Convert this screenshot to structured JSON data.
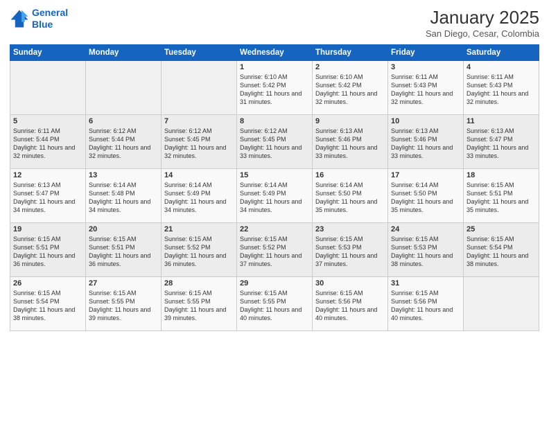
{
  "logo": {
    "line1": "General",
    "line2": "Blue"
  },
  "title": "January 2025",
  "location": "San Diego, Cesar, Colombia",
  "days_header": [
    "Sunday",
    "Monday",
    "Tuesday",
    "Wednesday",
    "Thursday",
    "Friday",
    "Saturday"
  ],
  "weeks": [
    [
      {
        "day": "",
        "info": ""
      },
      {
        "day": "",
        "info": ""
      },
      {
        "day": "",
        "info": ""
      },
      {
        "day": "1",
        "info": "Sunrise: 6:10 AM\nSunset: 5:42 PM\nDaylight: 11 hours\nand 31 minutes."
      },
      {
        "day": "2",
        "info": "Sunrise: 6:10 AM\nSunset: 5:42 PM\nDaylight: 11 hours\nand 32 minutes."
      },
      {
        "day": "3",
        "info": "Sunrise: 6:11 AM\nSunset: 5:43 PM\nDaylight: 11 hours\nand 32 minutes."
      },
      {
        "day": "4",
        "info": "Sunrise: 6:11 AM\nSunset: 5:43 PM\nDaylight: 11 hours\nand 32 minutes."
      }
    ],
    [
      {
        "day": "5",
        "info": "Sunrise: 6:11 AM\nSunset: 5:44 PM\nDaylight: 11 hours\nand 32 minutes."
      },
      {
        "day": "6",
        "info": "Sunrise: 6:12 AM\nSunset: 5:44 PM\nDaylight: 11 hours\nand 32 minutes."
      },
      {
        "day": "7",
        "info": "Sunrise: 6:12 AM\nSunset: 5:45 PM\nDaylight: 11 hours\nand 32 minutes."
      },
      {
        "day": "8",
        "info": "Sunrise: 6:12 AM\nSunset: 5:45 PM\nDaylight: 11 hours\nand 33 minutes."
      },
      {
        "day": "9",
        "info": "Sunrise: 6:13 AM\nSunset: 5:46 PM\nDaylight: 11 hours\nand 33 minutes."
      },
      {
        "day": "10",
        "info": "Sunrise: 6:13 AM\nSunset: 5:46 PM\nDaylight: 11 hours\nand 33 minutes."
      },
      {
        "day": "11",
        "info": "Sunrise: 6:13 AM\nSunset: 5:47 PM\nDaylight: 11 hours\nand 33 minutes."
      }
    ],
    [
      {
        "day": "12",
        "info": "Sunrise: 6:13 AM\nSunset: 5:47 PM\nDaylight: 11 hours\nand 34 minutes."
      },
      {
        "day": "13",
        "info": "Sunrise: 6:14 AM\nSunset: 5:48 PM\nDaylight: 11 hours\nand 34 minutes."
      },
      {
        "day": "14",
        "info": "Sunrise: 6:14 AM\nSunset: 5:49 PM\nDaylight: 11 hours\nand 34 minutes."
      },
      {
        "day": "15",
        "info": "Sunrise: 6:14 AM\nSunset: 5:49 PM\nDaylight: 11 hours\nand 34 minutes."
      },
      {
        "day": "16",
        "info": "Sunrise: 6:14 AM\nSunset: 5:50 PM\nDaylight: 11 hours\nand 35 minutes."
      },
      {
        "day": "17",
        "info": "Sunrise: 6:14 AM\nSunset: 5:50 PM\nDaylight: 11 hours\nand 35 minutes."
      },
      {
        "day": "18",
        "info": "Sunrise: 6:15 AM\nSunset: 5:51 PM\nDaylight: 11 hours\nand 35 minutes."
      }
    ],
    [
      {
        "day": "19",
        "info": "Sunrise: 6:15 AM\nSunset: 5:51 PM\nDaylight: 11 hours\nand 36 minutes."
      },
      {
        "day": "20",
        "info": "Sunrise: 6:15 AM\nSunset: 5:51 PM\nDaylight: 11 hours\nand 36 minutes."
      },
      {
        "day": "21",
        "info": "Sunrise: 6:15 AM\nSunset: 5:52 PM\nDaylight: 11 hours\nand 36 minutes."
      },
      {
        "day": "22",
        "info": "Sunrise: 6:15 AM\nSunset: 5:52 PM\nDaylight: 11 hours\nand 37 minutes."
      },
      {
        "day": "23",
        "info": "Sunrise: 6:15 AM\nSunset: 5:53 PM\nDaylight: 11 hours\nand 37 minutes."
      },
      {
        "day": "24",
        "info": "Sunrise: 6:15 AM\nSunset: 5:53 PM\nDaylight: 11 hours\nand 38 minutes."
      },
      {
        "day": "25",
        "info": "Sunrise: 6:15 AM\nSunset: 5:54 PM\nDaylight: 11 hours\nand 38 minutes."
      }
    ],
    [
      {
        "day": "26",
        "info": "Sunrise: 6:15 AM\nSunset: 5:54 PM\nDaylight: 11 hours\nand 38 minutes."
      },
      {
        "day": "27",
        "info": "Sunrise: 6:15 AM\nSunset: 5:55 PM\nDaylight: 11 hours\nand 39 minutes."
      },
      {
        "day": "28",
        "info": "Sunrise: 6:15 AM\nSunset: 5:55 PM\nDaylight: 11 hours\nand 39 minutes."
      },
      {
        "day": "29",
        "info": "Sunrise: 6:15 AM\nSunset: 5:55 PM\nDaylight: 11 hours\nand 40 minutes."
      },
      {
        "day": "30",
        "info": "Sunrise: 6:15 AM\nSunset: 5:56 PM\nDaylight: 11 hours\nand 40 minutes."
      },
      {
        "day": "31",
        "info": "Sunrise: 6:15 AM\nSunset: 5:56 PM\nDaylight: 11 hours\nand 40 minutes."
      },
      {
        "day": "",
        "info": ""
      }
    ]
  ]
}
